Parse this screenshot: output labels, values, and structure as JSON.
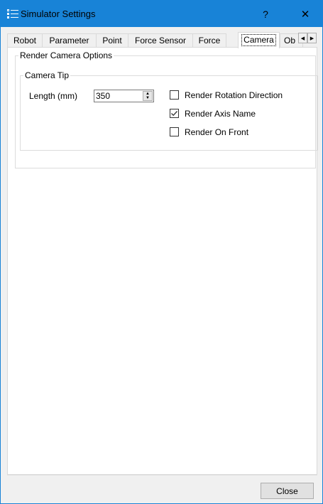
{
  "window": {
    "title": "Simulator Settings",
    "help_label": "?",
    "close_label": "✕",
    "app_icon": "settings-grid-icon",
    "accent_color": "#1883d7"
  },
  "tabs": [
    {
      "label": "Robot",
      "active": false
    },
    {
      "label": "Parameter",
      "active": false
    },
    {
      "label": "Point",
      "active": false
    },
    {
      "label": "Force Sensor",
      "active": false
    },
    {
      "label": "Force",
      "active": false
    },
    {
      "label": "Camera",
      "active": true
    },
    {
      "label": "Ob",
      "active": false
    }
  ],
  "tab_scroll": {
    "left_icon": "◀",
    "right_icon": "▶"
  },
  "render_camera": {
    "title": "Render Camera Options",
    "camera_tip": {
      "title": "Camera Tip",
      "length_label": "Length (mm)",
      "length_value": "350",
      "spin_up": "▲",
      "spin_down": "▼",
      "options": [
        {
          "label": "Render Rotation Direction",
          "checked": false
        },
        {
          "label": "Render Axis Name",
          "checked": true
        },
        {
          "label": "Render On Front",
          "checked": false
        }
      ]
    }
  },
  "footer": {
    "close_button": "Close"
  }
}
